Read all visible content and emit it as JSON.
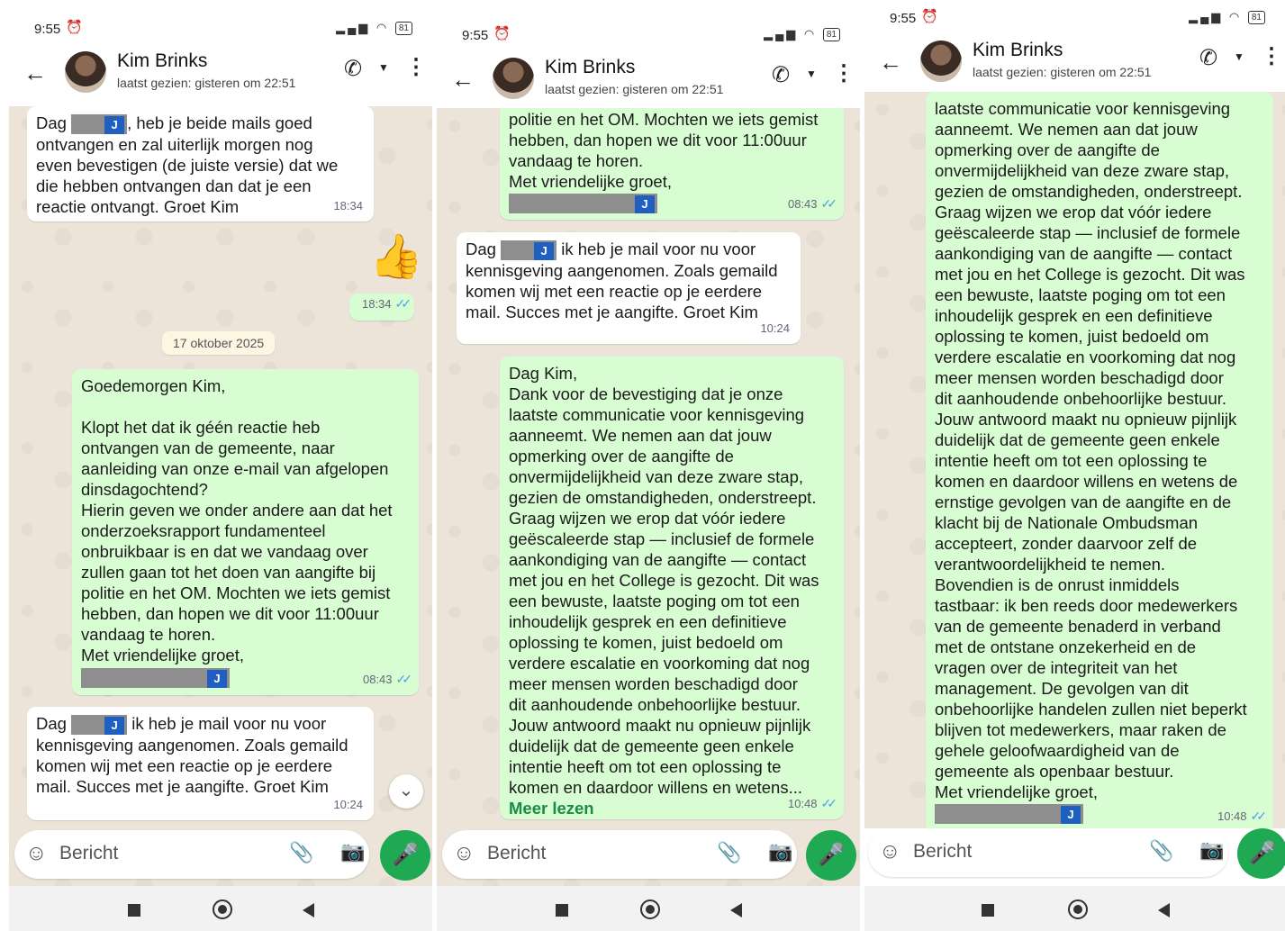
{
  "status": {
    "time": "9:55",
    "battery": "81"
  },
  "contact": {
    "name": "Kim Brinks",
    "last_seen": "laatst gezien: gisteren om 22:51"
  },
  "compose": {
    "placeholder": "Bericht"
  },
  "date_chip": "17 oktober 2025",
  "read_more": "Meer lezen",
  "badge": "J",
  "panel1": {
    "msg1": {
      "prefix": "Dag ",
      "text": ", heb je beide mails goed\nontvangen en zal uiterlijk morgen nog\neven bevestigen (de juiste versie) dat we\ndie hebben ontvangen dan dat je een\nreactie ontvangt. Groet Kim",
      "time": "18:34"
    },
    "thumb_time": "18:34",
    "msg2": {
      "text": "Goedemorgen Kim,\n\nKlopt het dat ik géén reactie heb\nontvangen van de gemeente, naar\naanleiding van onze e-mail van afgelopen\ndinsdagochtend?\nHierin geven we onder andere aan dat het\nonderzoeksrapport fundamenteel\nonbruikbaar is en dat we vandaag over\nzullen gaan tot het doen van aangifte bij\npolitie en het OM. Mochten we iets gemist\nhebben, dan hopen we dit voor 11:00uur\nvandaag te horen.\nMet vriendelijke groet,",
      "time": "08:43"
    },
    "msg3": {
      "prefix": "Dag ",
      "text": " ik heb je mail voor nu voor\nkennisgeving aangenomen. Zoals gemaild\nkomen wij met een reactie op je eerdere\nmail. Succes met je aangifte. Groet Kim",
      "time": "10:24"
    }
  },
  "panel2": {
    "msg1": {
      "text": "politie en het OM. Mochten we iets gemist\nhebben, dan hopen we dit voor 11:00uur\nvandaag te horen.\nMet vriendelijke groet,",
      "time": "08:43"
    },
    "msg2": {
      "prefix": "Dag ",
      "text": " ik heb je mail voor nu voor\nkennisgeving aangenomen. Zoals gemaild\nkomen wij met een reactie op je eerdere\nmail. Succes met je aangifte. Groet Kim",
      "time": "10:24"
    },
    "msg3": {
      "text": "Dag Kim,\nDank voor de bevestiging dat je onze\nlaatste communicatie voor kennisgeving\naanneemt. We nemen aan dat jouw\nopmerking over de aangifte de\nonvermijdelijkheid van deze zware stap,\ngezien de omstandigheden, onderstreept.\nGraag wijzen we erop dat vóór iedere\ngeëscaleerde stap — inclusief de formele\naankondiging van de aangifte — contact\nmet jou en het College is gezocht. Dit was\neen bewuste, laatste poging om tot een\ninhoudelijk gesprek en een definitieve\noplossing te komen, juist bedoeld om\nverdere escalatie en voorkoming dat nog\nmeer mensen worden beschadigd door\ndit aanhoudende onbehoorlijke bestuur.\nJouw antwoord maakt nu opnieuw pijnlijk\nduidelijk dat de gemeente geen enkele\nintentie heeft om tot een oplossing te\nkomen en daardoor willens en wetens...",
      "time": "10:48"
    }
  },
  "panel3": {
    "msg1": {
      "text": "laatste communicatie voor kennisgeving\naanneemt. We nemen aan dat jouw\nopmerking over de aangifte de\nonvermijdelijkheid van deze zware stap,\ngezien de omstandigheden, onderstreept.\nGraag wijzen we erop dat vóór iedere\ngeëscaleerde stap — inclusief de formele\naankondiging van de aangifte — contact\nmet jou en het College is gezocht. Dit was\neen bewuste, laatste poging om tot een\ninhoudelijk gesprek en een definitieve\noplossing te komen, juist bedoeld om\nverdere escalatie en voorkoming dat nog\nmeer mensen worden beschadigd door\ndit aanhoudende onbehoorlijke bestuur.\nJouw antwoord maakt nu opnieuw pijnlijk\nduidelijk dat de gemeente geen enkele\nintentie heeft om tot een oplossing te\nkomen en daardoor willens en wetens de\nernstige gevolgen van de aangifte en de\nklacht bij de Nationale Ombudsman\naccepteert, zonder daarvoor zelf de\nverantwoordelijkheid te nemen.\nBovendien is de onrust inmiddels\ntastbaar: ik ben reeds door medewerkers\nvan de gemeente benaderd in verband\nmet de ontstane onzekerheid en de\nvragen over de integriteit van het\nmanagement. De gevolgen van dit\nonbehoorlijke handelen zullen niet beperkt\nblijven tot medewerkers, maar raken de\ngehele geloofwaardigheid van de\ngemeente als openbaar bestuur.\nMet vriendelijke groet,",
      "time": "10:48"
    }
  }
}
